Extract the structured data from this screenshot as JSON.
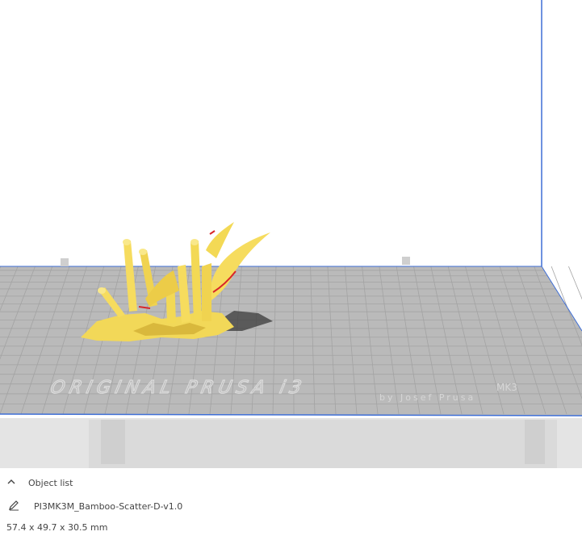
{
  "colors": {
    "background": "#ffffff",
    "build_volume_edge": "#3f6fd6",
    "bed_surface": "#b9b9b9",
    "bed_grid": "#9c9c9c",
    "bed_frame": "#dcdcdc",
    "model": "#f7e06a",
    "model_shade": "#e8c743",
    "overhang_highlight": "#d8262a",
    "shadow": "#3a3a3a"
  },
  "bed": {
    "logo_text": "ORIGINAL PRUSA i3",
    "logo_suffix": "MK3",
    "logo_subtext": "by Josef Prusa"
  },
  "object_list": {
    "header_icon": "chevron-up-icon",
    "header_label": "Object list",
    "edit_icon": "pencil-icon",
    "object_name": "PI3MK3M_Bamboo-Scatter-D-v1.0",
    "dimensions": "57.4 x 49.7 x 30.5 mm"
  }
}
